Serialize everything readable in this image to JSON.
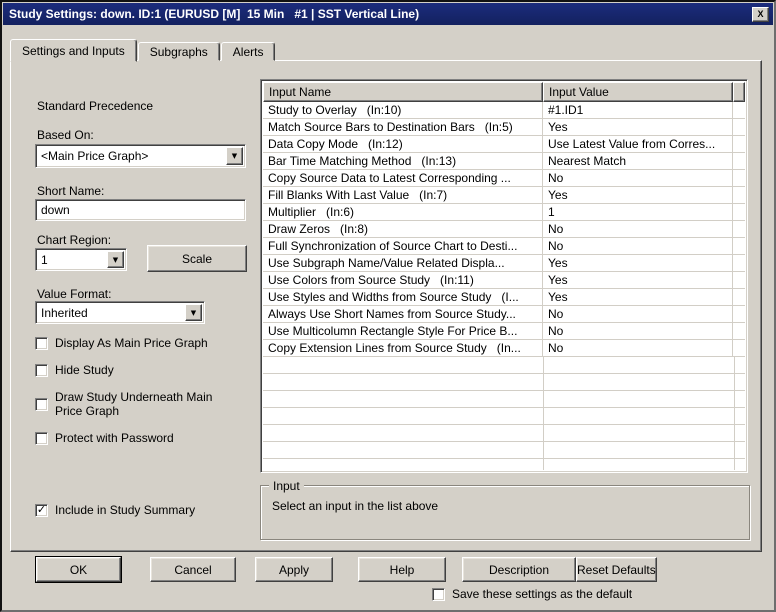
{
  "window": {
    "title": "Study Settings: down. ID:1 (EURUSD [M]  15 Min   #1 | SST Vertical Line)"
  },
  "icons": {
    "close": "X",
    "dropdown": "▼",
    "check": "✓"
  },
  "tabs": [
    {
      "label": "Settings and Inputs",
      "active": true
    },
    {
      "label": "Subgraphs",
      "active": false
    },
    {
      "label": "Alerts",
      "active": false
    }
  ],
  "left_panel": {
    "heading": "Standard Precedence",
    "based_on_label": "Based On:",
    "based_on_value": "<Main Price Graph>",
    "short_name_label": "Short Name:",
    "short_name_value": "down",
    "chart_region_label": "Chart Region:",
    "chart_region_value": "1",
    "scale_button_label": "Scale",
    "value_format_label": "Value Format:",
    "value_format_value": "Inherited",
    "checkboxes": [
      {
        "label": "Display As Main Price Graph",
        "checked": false
      },
      {
        "label": "Hide Study",
        "checked": false
      },
      {
        "label": "Draw Study Underneath Main Price Graph",
        "checked": false
      },
      {
        "label": "Protect with Password",
        "checked": false
      }
    ],
    "include_in_summary": {
      "label": "Include in Study Summary",
      "checked": true
    }
  },
  "inputs_table": {
    "name_header": "Input Name",
    "value_header": "Input Value",
    "rows": [
      {
        "name": "Study to Overlay   (In:10)",
        "value": "#1.ID1"
      },
      {
        "name": "Match Source Bars to Destination Bars   (In:5)",
        "value": "Yes"
      },
      {
        "name": "Data Copy Mode   (In:12)",
        "value": "Use Latest Value from Corres..."
      },
      {
        "name": "Bar Time Matching Method   (In:13)",
        "value": "Nearest Match"
      },
      {
        "name": "Copy Source Data to Latest Corresponding ...",
        "value": "No"
      },
      {
        "name": "Fill Blanks With Last Value   (In:7)",
        "value": "Yes"
      },
      {
        "name": "Multiplier   (In:6)",
        "value": "1"
      },
      {
        "name": "Draw Zeros   (In:8)",
        "value": "No"
      },
      {
        "name": "Full Synchronization of Source Chart to Desti...",
        "value": "No"
      },
      {
        "name": "Use Subgraph Name/Value Related Displa...",
        "value": "Yes"
      },
      {
        "name": "Use Colors from Source Study   (In:11)",
        "value": "Yes"
      },
      {
        "name": "Use Styles and Widths from Source Study   (I...",
        "value": "Yes"
      },
      {
        "name": "Always Use Short Names from Source Study...",
        "value": "No"
      },
      {
        "name": "Use Multicolumn Rectangle Style For Price B...",
        "value": "No"
      },
      {
        "name": "Copy Extension Lines from Source Study   (In...",
        "value": "No"
      }
    ]
  },
  "input_group": {
    "title": "Input",
    "message": "Select an input in the list above"
  },
  "footer": {
    "buttons": [
      {
        "label": "OK",
        "default": true
      },
      {
        "label": "Cancel",
        "default": false
      },
      {
        "label": "Apply",
        "default": false
      },
      {
        "label": "Help",
        "default": false
      },
      {
        "label": "Description",
        "default": false
      },
      {
        "label": "Reset Defaults",
        "default": false
      }
    ],
    "save_default": {
      "label": "Save these settings as the default",
      "checked": false
    }
  }
}
